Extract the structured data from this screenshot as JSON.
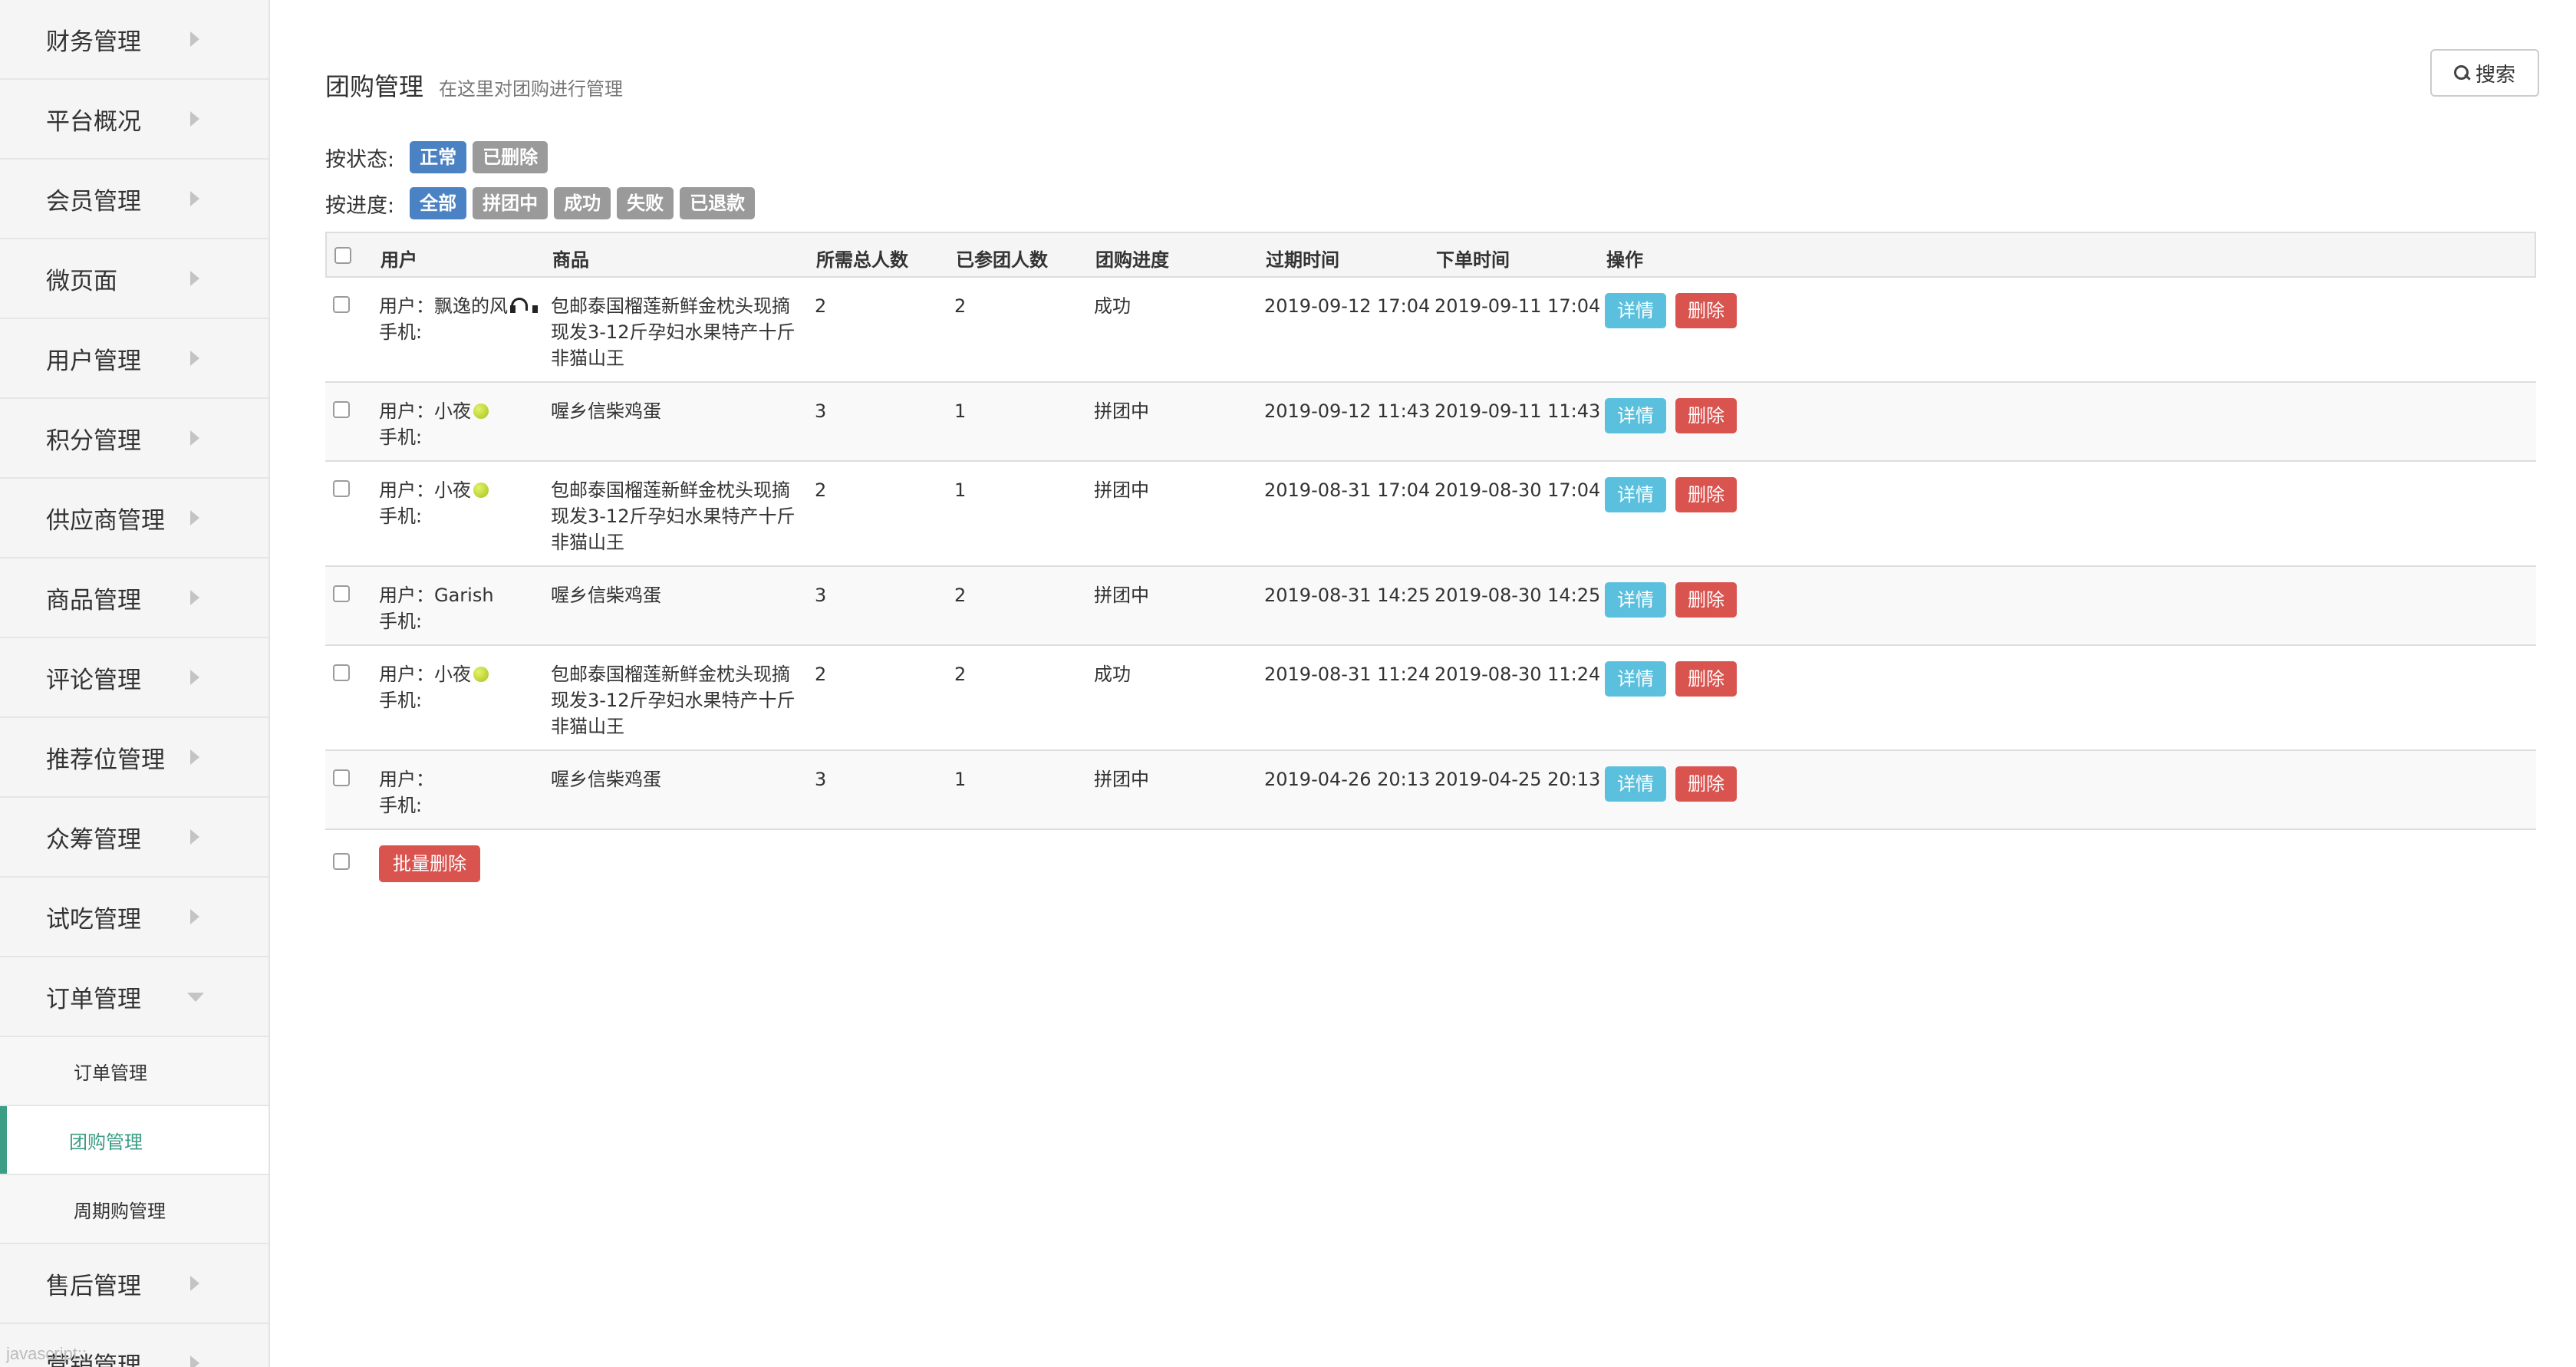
{
  "sidebar": {
    "items_top": [
      {
        "label": "财务管理"
      },
      {
        "label": "平台概况"
      },
      {
        "label": "会员管理"
      },
      {
        "label": "微页面"
      },
      {
        "label": "用户管理"
      },
      {
        "label": "积分管理"
      },
      {
        "label": "供应商管理"
      },
      {
        "label": "商品管理"
      },
      {
        "label": "评论管理"
      },
      {
        "label": "推荐位管理"
      },
      {
        "label": "众筹管理"
      },
      {
        "label": "试吃管理"
      },
      {
        "label": "订单管理"
      }
    ],
    "sub_items": [
      {
        "label": "订单管理"
      },
      {
        "label": "团购管理",
        "active": true
      },
      {
        "label": "周期购管理"
      }
    ],
    "items_bottom": [
      {
        "label": "售后管理"
      },
      {
        "label": "营销管理"
      }
    ],
    "status_text": "javascript:;"
  },
  "header": {
    "title": "团购管理",
    "subtitle": "在这里对团购进行管理",
    "search_label": "搜索"
  },
  "filters": {
    "status_label": "按状态:",
    "status_tags": [
      "正常",
      "已删除"
    ],
    "status_active": 0,
    "progress_label": "按进度:",
    "progress_tags": [
      "全部",
      "拼团中",
      "成功",
      "失败",
      "已退款"
    ],
    "progress_active": 0
  },
  "table": {
    "columns": [
      "用户",
      "商品",
      "所需总人数",
      "已参团人数",
      "团购进度",
      "过期时间",
      "下单时间",
      "操作"
    ],
    "user_prefix": "用户：",
    "phone_prefix": "手机:",
    "detail_label": "详情",
    "delete_label": "删除",
    "rows": [
      {
        "user": "飘逸的风",
        "user_emoji": "headphone",
        "goods": "包邮泰国榴莲新鲜金枕头现摘现发3-12斤孕妇水果特产十斤非猫山王",
        "required": "2",
        "joined": "2",
        "progress": "成功",
        "expire": "2019-09-12 17:04",
        "order_time": "2019-09-11 17:04"
      },
      {
        "user": "小夜",
        "user_emoji": "ball",
        "goods": "喔乡信柴鸡蛋",
        "required": "3",
        "joined": "1",
        "progress": "拼团中",
        "expire": "2019-09-12 11:43",
        "order_time": "2019-09-11 11:43"
      },
      {
        "user": "小夜",
        "user_emoji": "ball",
        "goods": "包邮泰国榴莲新鲜金枕头现摘现发3-12斤孕妇水果特产十斤非猫山王",
        "required": "2",
        "joined": "1",
        "progress": "拼团中",
        "expire": "2019-08-31 17:04",
        "order_time": "2019-08-30 17:04"
      },
      {
        "user": "Garish",
        "user_emoji": "",
        "goods": "喔乡信柴鸡蛋",
        "required": "3",
        "joined": "2",
        "progress": "拼团中",
        "expire": "2019-08-31 14:25",
        "order_time": "2019-08-30 14:25"
      },
      {
        "user": "小夜",
        "user_emoji": "ball",
        "goods": "包邮泰国榴莲新鲜金枕头现摘现发3-12斤孕妇水果特产十斤非猫山王",
        "required": "2",
        "joined": "2",
        "progress": "成功",
        "expire": "2019-08-31 11:24",
        "order_time": "2019-08-30 11:24"
      },
      {
        "user": "",
        "user_emoji": "",
        "goods": "喔乡信柴鸡蛋",
        "required": "3",
        "joined": "1",
        "progress": "拼团中",
        "expire": "2019-04-26 20:13",
        "order_time": "2019-04-25 20:13"
      }
    ]
  },
  "bulk_delete_label": "批量删除"
}
